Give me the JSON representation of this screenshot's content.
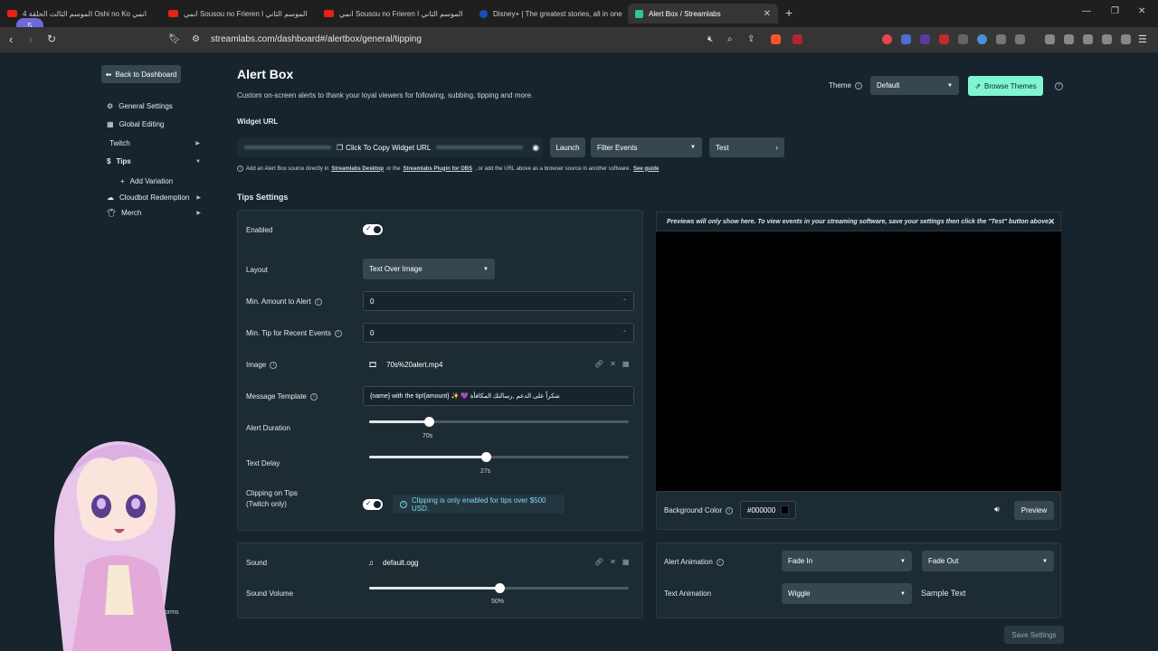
{
  "browser": {
    "tab_count": "5",
    "tabs": [
      {
        "label": "الموسم الثالث الحلقة 4 Oshi no Ko انمي",
        "color": "#e62117"
      },
      {
        "label": "انمي Sousou no Frieren الموسم الثاني ا",
        "color": "#e62117"
      },
      {
        "label": "انمي Sousou no Frieren الموسم الثاني ا",
        "color": "#e62117"
      },
      {
        "label": "Disney+ | The greatest stories, all in one",
        "color": "#1a4dbf"
      },
      {
        "label": "Alert Box / Streamlabs",
        "color": "#31c3a2"
      }
    ],
    "url": "streamlabs.com/dashboard#/alertbox/general/tipping"
  },
  "sidebar": {
    "back_label": "Back to Dashboard",
    "items": [
      {
        "label": "General Settings",
        "icon": "gear-icon"
      },
      {
        "label": "Global Editing",
        "icon": "grid-icon"
      },
      {
        "label": "Twitch",
        "icon": ""
      },
      {
        "label": "Tips",
        "icon": "dollar-icon"
      },
      {
        "label": "Add Variation",
        "icon": "plus-icon"
      },
      {
        "label": "Cloudbot Redemption",
        "icon": "cloud-icon"
      },
      {
        "label": "Merch",
        "icon": "shirt-icon"
      }
    ]
  },
  "header": {
    "title": "Alert Box",
    "subtitle": "Custom on-screen alerts to thank your loyal viewers for following, subbing, tipping and more.",
    "theme_label": "Theme",
    "theme_value": "Default",
    "browse_themes": "Browse Themes"
  },
  "widget": {
    "section_label": "Widget URL",
    "copy_label": "Click To Copy Widget URL",
    "launch": "Launch",
    "filter_events": "Filter Events",
    "test": "Test",
    "help_prefix": "Add an Alert Box source directly in",
    "help_link1": "Streamlabs Desktop",
    "help_mid": "or the",
    "help_link2": "Streamlabs Plugin for OBS",
    "help_suffix": ", or add the URL above as a browser source in another software.",
    "help_link3": "See guide"
  },
  "tips_settings": {
    "title": "Tips Settings",
    "enabled_label": "Enabled",
    "layout_label": "Layout",
    "layout_value": "Text Over Image",
    "min_amount_label": "Min. Amount to Alert",
    "min_amount_value": "0",
    "min_tip_label": "Min. Tip for Recent Events",
    "min_tip_value": "0",
    "image_label": "Image",
    "image_value": "70s%20alert.mp4",
    "template_label": "Message Template",
    "template_value": "{name} with the tip!{amount} ✨ 💜 شكراً على الدعم ,رسالتك المكافأة",
    "duration_label": "Alert Duration",
    "duration_value": "70s",
    "duration_fraction": 0.23,
    "delay_label": "Text Delay",
    "delay_value": "27s",
    "delay_fraction": 0.45,
    "clipping_label_1": "Clipping on Tips",
    "clipping_label_2": "(Twitch only)",
    "clipping_note": "Clipping is only enabled for tips over $500 USD."
  },
  "preview": {
    "notice": "Previews will only show here. To view events in your streaming software, save your settings then click the \"Test\" button above.",
    "bg_label": "Background Color",
    "bg_value": "#000000",
    "preview_btn": "Preview"
  },
  "sound": {
    "sound_label": "Sound",
    "sound_value": "default.ogg",
    "volume_label": "Sound Volume",
    "volume_value": "50%",
    "volume_fraction": 0.5
  },
  "animation": {
    "alert_label": "Alert Animation",
    "in_value": "Fade In",
    "out_value": "Fade Out",
    "text_label": "Text Animation",
    "text_value": "Wiggle",
    "sample": "Sample Text"
  },
  "footer": {
    "save": "Save Settings",
    "partial": "forms"
  },
  "colors": {
    "accent": "#80f5d2",
    "bg": "#17242d",
    "panel": "#1d2b33",
    "control": "#37474f"
  }
}
